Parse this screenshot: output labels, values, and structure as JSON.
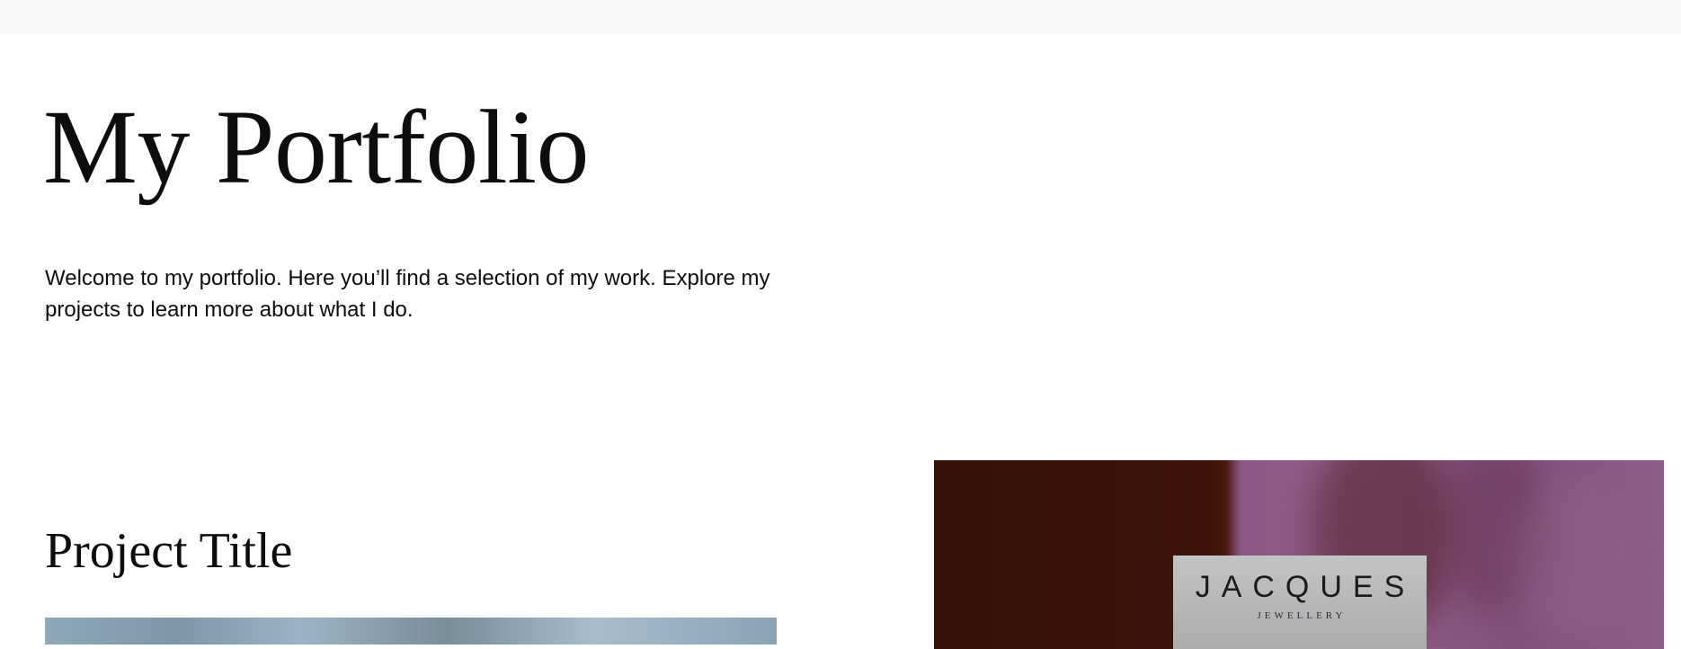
{
  "header": {
    "title": "My Portfolio",
    "intro": "Welcome to my portfolio. Here you’ll find a selection of my work. Explore my projects to learn more about what I do."
  },
  "projects": [
    {
      "title": "Project Title",
      "image": "project-image-blue-gray"
    },
    {
      "image": "project-image-jacques-jewellery",
      "brand_name": "JACQUES",
      "brand_sub": "JEWELLERY"
    }
  ],
  "colors": {
    "top_bar": "#f7f7f7",
    "text": "#0d0d0d",
    "maroon": "#3f130b",
    "mauve": "#8c5783"
  }
}
